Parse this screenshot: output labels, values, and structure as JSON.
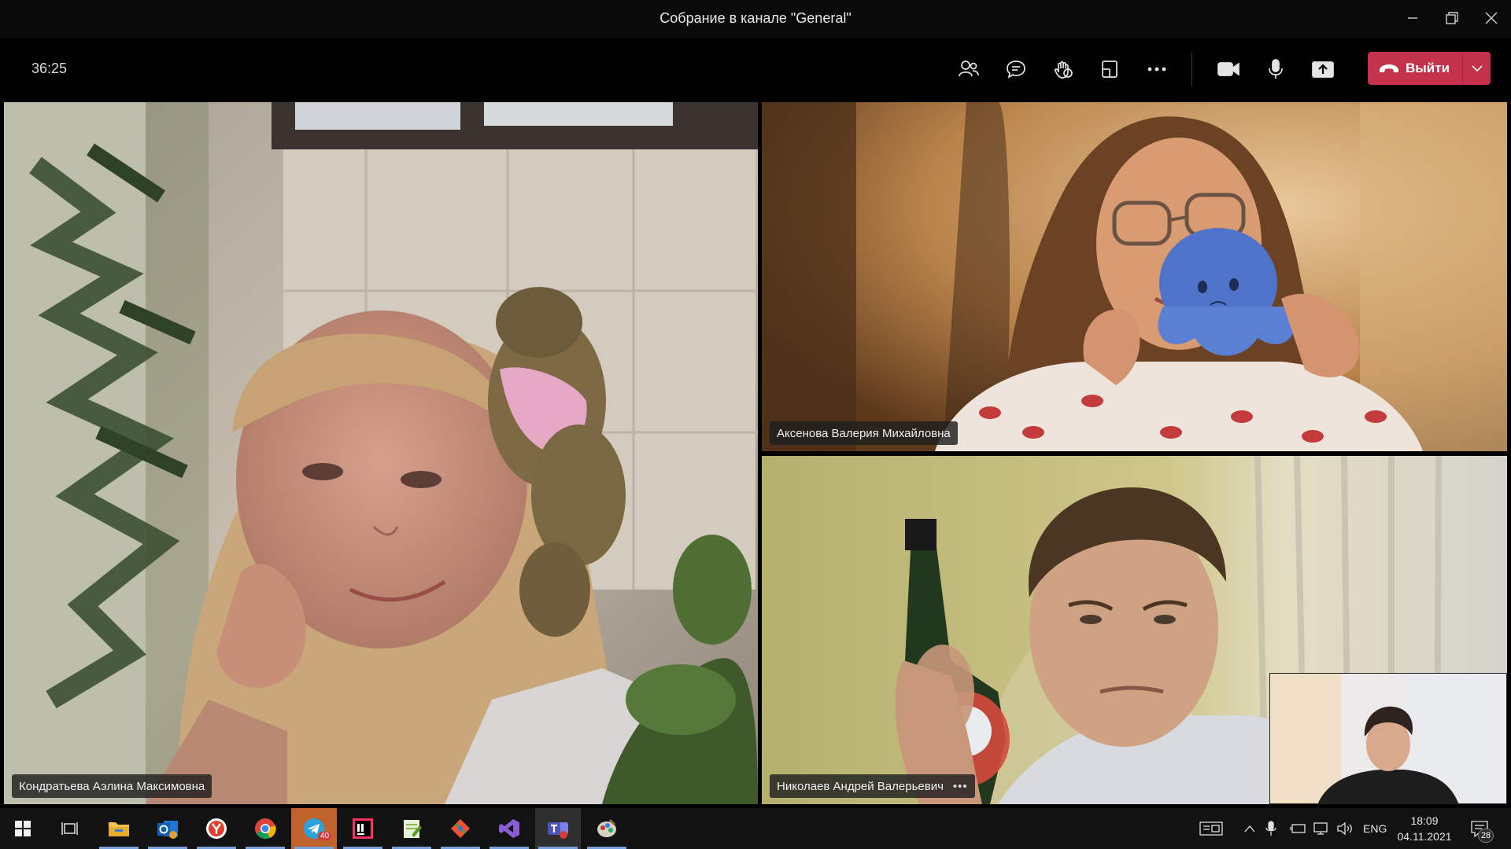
{
  "window": {
    "title": "Собрание в канале \"General\""
  },
  "toolbar": {
    "timer": "36:25",
    "leave_label": "Выйти",
    "buttons": [
      "participants-icon",
      "chat-icon",
      "raise-hand-icon",
      "rooms-icon",
      "more-icon",
      "camera-icon",
      "microphone-icon",
      "share-icon"
    ]
  },
  "participants": [
    {
      "name": "Кондратьева Аэлина Максимовна"
    },
    {
      "name": "Аксенова Валерия Михайловна"
    },
    {
      "name": "Николаев Андрей Валерьевич",
      "more": "•••"
    }
  ],
  "self_view": {
    "label": ""
  },
  "taskbar": {
    "apps": [
      "windows-start-icon",
      "task-view-icon",
      "file-explorer-icon",
      "outlook-icon",
      "yandex-browser-icon",
      "chrome-icon",
      "telegram-icon",
      "intellij-icon",
      "notepad-plus-icon",
      "git-icon",
      "visual-studio-icon",
      "teams-icon",
      "misc-app-icon"
    ],
    "telegram_badge": "40",
    "language": "ENG",
    "time": "18:09",
    "date": "04.11.2021",
    "notifications": "28"
  },
  "colors": {
    "leave_red": "#c4314b",
    "active_underline": "#7aa0d9",
    "teams_purple": "#6264a7"
  }
}
